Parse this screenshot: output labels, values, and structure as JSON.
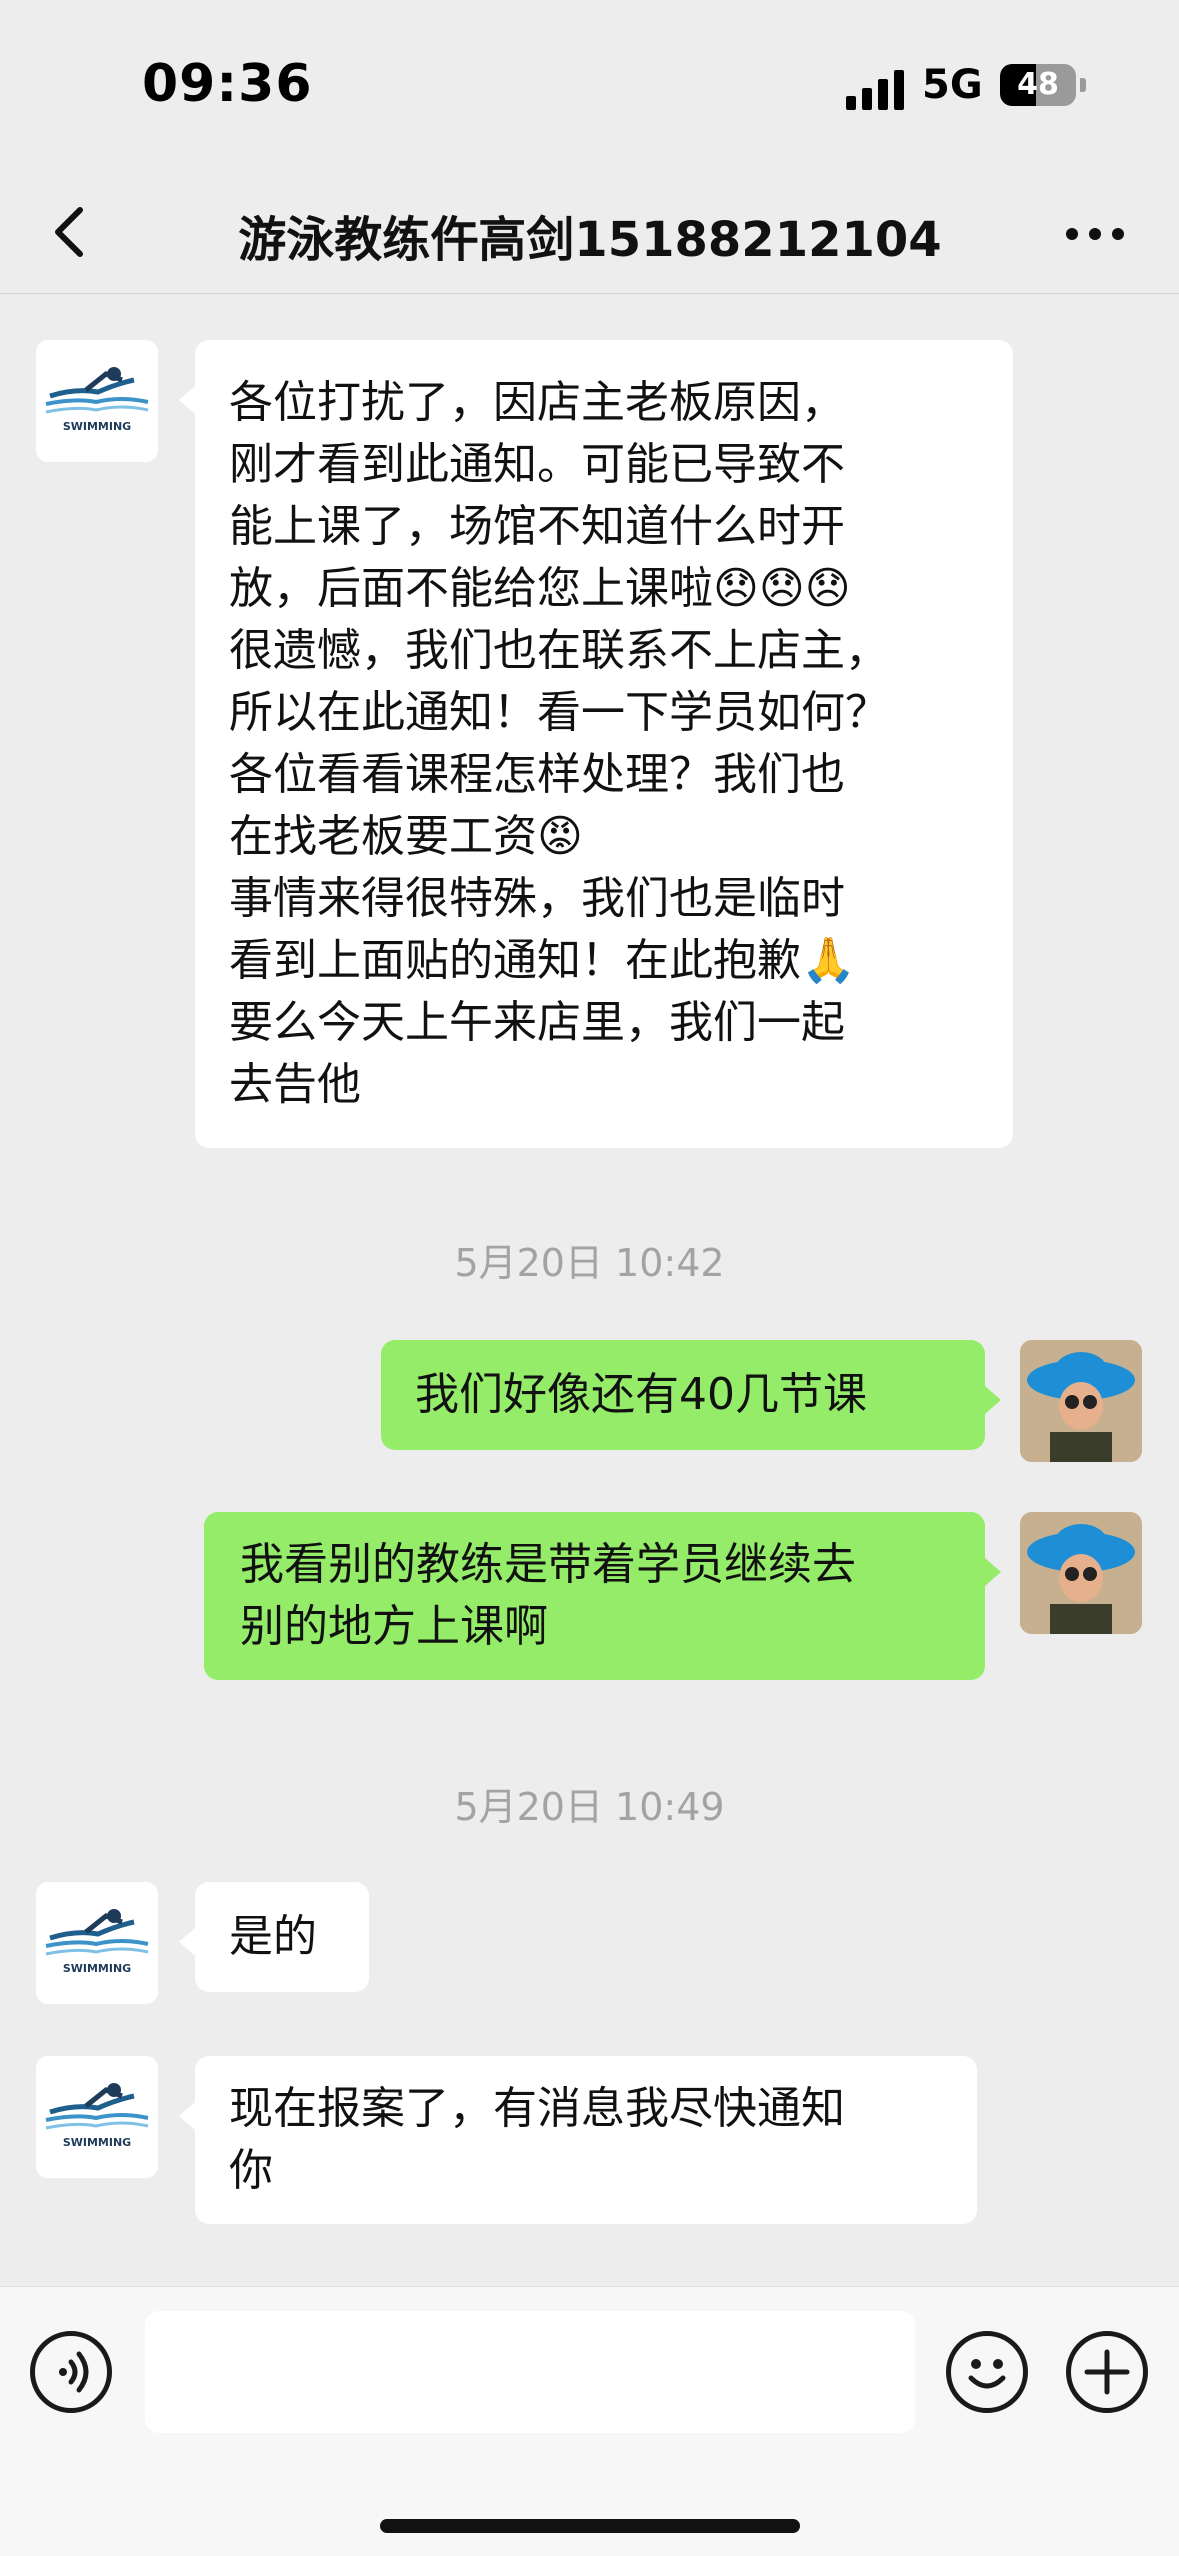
{
  "status_bar": {
    "time": "09:36",
    "network": "5G",
    "battery": "48",
    "battery_level": 0.48
  },
  "nav": {
    "title": "游泳教练仵高剑15188212104"
  },
  "messages": [
    {
      "side": "left",
      "sender_avatar": "swimming-logo",
      "avatar_text": "SWIMMING",
      "text": "各位打扰了，因店主老板原因，\n刚才看到此通知。可能已导致不\n能上课了，场馆不知道什么时开\n放，后面不能给您上课啦😞😞😞\n很遗憾，我们也在联系不上店主，\n所以在此通知！看一下学员如何？\n各位看看课程怎样处理？我们也\n在找老板要工资😡\n事情来得很特殊，我们也是临时\n看到上面贴的通知！在此抱歉🙏\n要么今天上午来店里，我们一起\n去告他"
    },
    {
      "timestamp": "5月20日 10:42"
    },
    {
      "side": "right",
      "text": "我们好像还有40几节课"
    },
    {
      "side": "right",
      "text": "我看别的教练是带着学员继续去\n别的地方上课啊"
    },
    {
      "timestamp": "5月20日 10:49"
    },
    {
      "side": "left",
      "avatar_text": "SWIMMING",
      "text": "是的"
    },
    {
      "side": "left",
      "avatar_text": "SWIMMING",
      "text": "现在报案了，有消息我尽快通知\n你"
    }
  ],
  "input_bar": {
    "value": ""
  },
  "icons": {
    "back": "chevron-left-icon",
    "more": "more-dots-icon",
    "voice": "voice-icon",
    "emoji": "emoji-icon",
    "plus": "plus-icon"
  },
  "colors": {
    "background": "#ededed",
    "bubble_self": "#95ec69",
    "bubble_other": "#ffffff"
  }
}
